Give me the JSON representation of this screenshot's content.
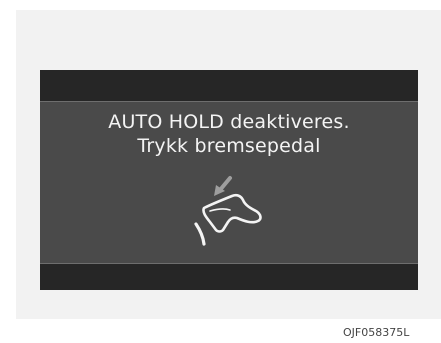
{
  "message": {
    "line1": "AUTO HOLD deaktiveres.",
    "line2": "Trykk bremsepedal"
  },
  "icon": "press-brake-pedal-icon",
  "image_code": "OJF058375L",
  "colors": {
    "display_background": "#4a4a4a",
    "display_bars": "#262626",
    "text": "#f4f4f4",
    "panel_background": "#f2f2f2"
  }
}
